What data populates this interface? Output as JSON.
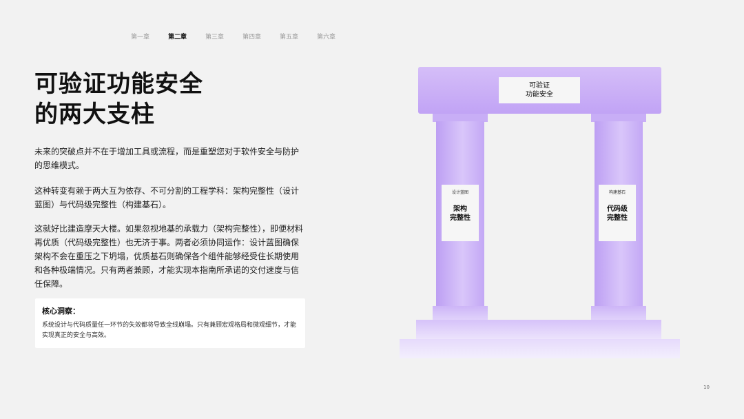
{
  "chapters": [
    "第一章",
    "第二章",
    "第三章",
    "第四章",
    "第五章",
    "第六章"
  ],
  "active_chapter": "第二章",
  "title": {
    "line1": "可验证功能安全",
    "line2": "的两大支柱"
  },
  "paragraphs": [
    "未来的突破点并不在于增加工具或流程，而是重塑您对于软件安全与防护的思维模式。",
    "这种转变有赖于两大互为依存、不可分割的工程学科：架构完整性（设计蓝图）与代码级完整性（构建基石）。",
    "这就好比建造摩天大楼。如果忽视地基的承载力（架构完整性），即便材料再优质（代码级完整性）也无济于事。两者必须协同运作：设计蓝图确保架构不会在重压之下坍塌，优质基石则确保各个组件能够经受住长期使用和各种极端情况。只有两者兼顾，才能实现本指南所承诺的交付速度与信任保障。"
  ],
  "insight": {
    "title": "核心洞察：",
    "text": "系统设计与代码质量任一环节的失效都将导致全线崩塌。只有兼顾宏观格局和微观细节，才能实现真正的安全与高效。"
  },
  "diagram": {
    "lintel_label": {
      "line1": "可验证",
      "line2": "功能安全"
    },
    "left_pillar": {
      "small": "设计蓝图",
      "line1": "架构",
      "line2": "完整性"
    },
    "right_pillar": {
      "small": "构建基石",
      "line1": "代码级",
      "line2": "完整性"
    },
    "accent_color": "#c1a3f5"
  },
  "page_number": "10"
}
